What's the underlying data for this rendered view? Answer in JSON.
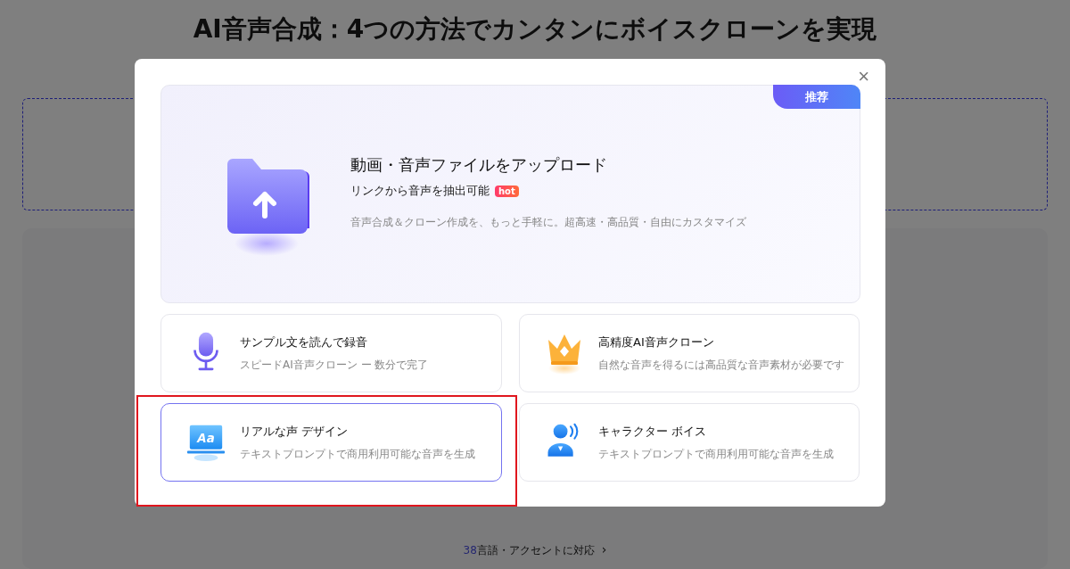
{
  "page": {
    "title": "AI音声合成：4つの方法でカンタンにボイスクローンを実現",
    "footer_link": {
      "count": "38",
      "label": "言語・アクセントに対応",
      "arrow": "›"
    }
  },
  "dialog": {
    "close": "×",
    "featured": {
      "badge": "推荐",
      "title": "動画・音声ファイルをアップロード",
      "subtitle": "リンクから音声を抽出可能",
      "tag": "hot",
      "description": "音声合成＆クローン作成を、もっと手軽に。超高速・高品質・自由にカスタマイズ"
    },
    "options": [
      {
        "title": "サンプル文を読んで録音",
        "description": "スピードAI音声クローン ー 数分で完了",
        "selected": false,
        "highlighted": false
      },
      {
        "title": "高精度AI音声クローン",
        "description": "自然な音声を得るには高品質な音声素材が必要です",
        "selected": false,
        "highlighted": false
      },
      {
        "icon_label": "Aa",
        "title": "リアルな声 デザイン",
        "description": "テキストプロンプトで商用利用可能な音声を生成",
        "selected": true,
        "highlighted": true
      },
      {
        "title": "キャラクター ボイス",
        "description": "テキストプロンプトで商用利用可能な音声を生成",
        "selected": false,
        "highlighted": false
      }
    ]
  }
}
